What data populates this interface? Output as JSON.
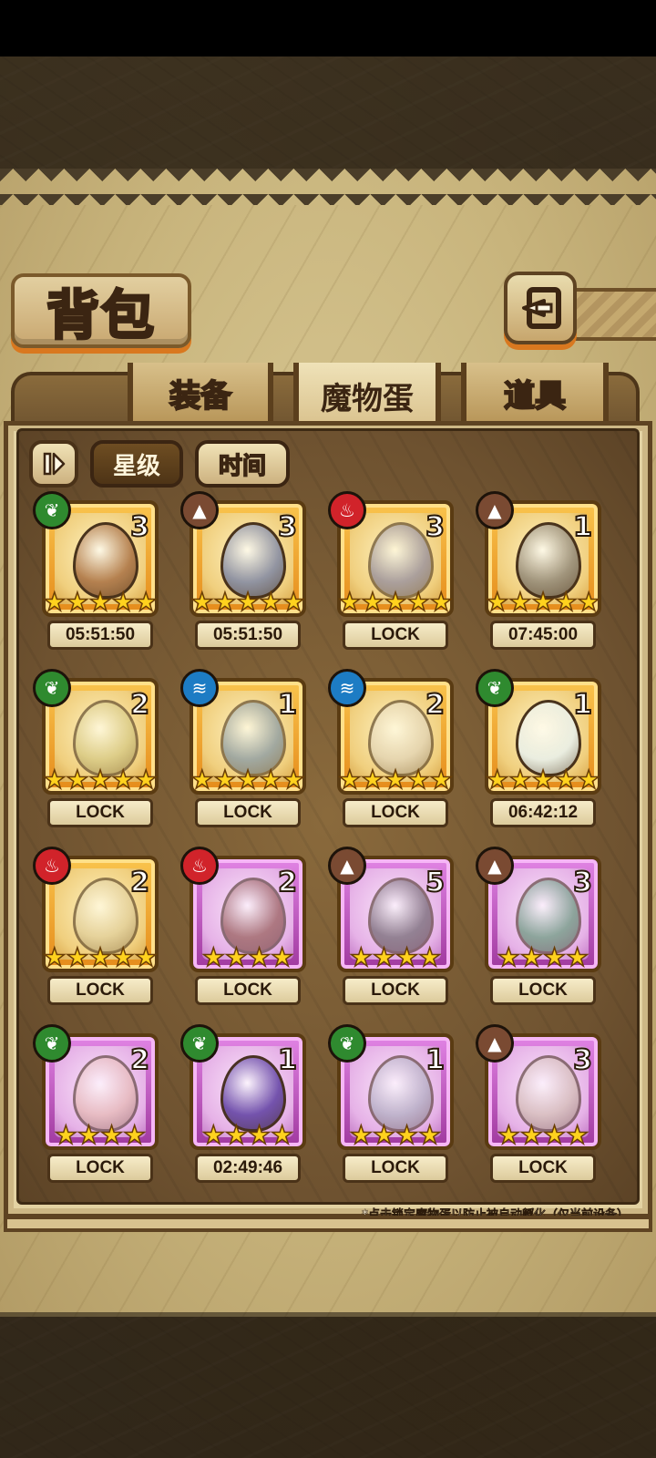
{
  "header": {
    "title": "背包"
  },
  "tabs": [
    {
      "label": "装备",
      "active": false
    },
    {
      "label": "魔物蛋",
      "active": true
    },
    {
      "label": "道具",
      "active": false
    }
  ],
  "sort": {
    "star_label": "星级",
    "time_label": "时间",
    "selected": "星级"
  },
  "eggs": [
    {
      "element": "grass",
      "count": "3",
      "stars": 5,
      "rarity": "gold",
      "label": "05:51:50",
      "icon": "lyre-egg-icon"
    },
    {
      "element": "rock",
      "count": "3",
      "stars": 5,
      "rarity": "gold",
      "label": "05:51:50",
      "icon": "sword-egg-icon"
    },
    {
      "element": "fire",
      "count": "3",
      "stars": 5,
      "rarity": "gold",
      "label": "LOCK",
      "icon": "eye-orb-egg-icon"
    },
    {
      "element": "rock",
      "count": "1",
      "stars": 5,
      "rarity": "gold",
      "label": "07:45:00",
      "icon": "pyramid-egg-icon"
    },
    {
      "element": "grass",
      "count": "2",
      "stars": 5,
      "rarity": "gold",
      "label": "LOCK",
      "icon": "leaf-egg-icon"
    },
    {
      "element": "water",
      "count": "1",
      "stars": 5,
      "rarity": "gold",
      "label": "LOCK",
      "icon": "shark-egg-icon"
    },
    {
      "element": "water",
      "count": "2",
      "stars": 5,
      "rarity": "gold",
      "label": "LOCK",
      "icon": "swirl-egg-icon"
    },
    {
      "element": "grass",
      "count": "1",
      "stars": 5,
      "rarity": "gold",
      "label": "06:42:12",
      "icon": "sprout-egg-icon"
    },
    {
      "element": "fire",
      "count": "2",
      "stars": 5,
      "rarity": "gold",
      "label": "LOCK",
      "icon": "tiger-egg-icon"
    },
    {
      "element": "fire",
      "count": "2",
      "stars": 4,
      "rarity": "purple",
      "label": "LOCK",
      "icon": "crab-egg-icon"
    },
    {
      "element": "rock",
      "count": "5",
      "stars": 4,
      "rarity": "purple",
      "label": "LOCK",
      "icon": "beetle-egg-icon"
    },
    {
      "element": "rock",
      "count": "3",
      "stars": 4,
      "rarity": "purple",
      "label": "LOCK",
      "icon": "jade-orb-egg-icon"
    },
    {
      "element": "grass",
      "count": "2",
      "stars": 4,
      "rarity": "purple",
      "label": "LOCK",
      "icon": "bunny-egg-icon"
    },
    {
      "element": "grass",
      "count": "1",
      "stars": 4,
      "rarity": "purple",
      "label": "02:49:46",
      "icon": "moth-egg-icon"
    },
    {
      "element": "grass",
      "count": "1",
      "stars": 4,
      "rarity": "purple",
      "label": "LOCK",
      "icon": "wing-egg-icon"
    },
    {
      "element": "rock",
      "count": "3",
      "stars": 4,
      "rarity": "purple",
      "label": "LOCK",
      "icon": "feather-egg-icon"
    }
  ],
  "element_icons": {
    "grass": "leaf-element-icon",
    "rock": "mountain-element-icon",
    "fire": "flame-element-icon",
    "water": "wave-element-icon"
  },
  "footnote": "*点击锁定魔物蛋以防止被自动孵化（仅当前设备）"
}
